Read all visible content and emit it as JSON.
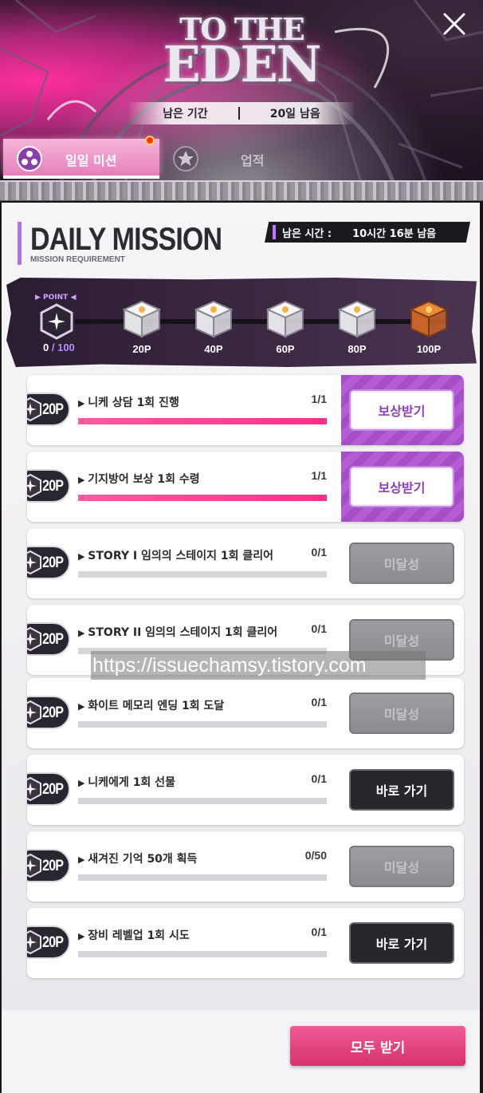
{
  "header": {
    "logo_line1": "TO THE",
    "logo_line2": "EDEN",
    "period_label": "남은 기간",
    "period_value": "20일 남음",
    "tabs": [
      {
        "label": "일일 미션",
        "active": true,
        "has_notification": true
      },
      {
        "label": "업적",
        "active": false
      }
    ]
  },
  "panel": {
    "title": "DAILY MISSION",
    "subtitle": "MISSION REQUIREMENT",
    "remaining_label": "남은 시간 :",
    "remaining_value": "10시간 16분 남음"
  },
  "points": {
    "label": "▶ POINT ◀",
    "current": "0",
    "total": "/ 100",
    "milestones": [
      {
        "label": "20P",
        "type": "silver"
      },
      {
        "label": "40P",
        "type": "silver"
      },
      {
        "label": "60P",
        "type": "silver"
      },
      {
        "label": "80P",
        "type": "silver"
      },
      {
        "label": "100P",
        "type": "gold"
      }
    ]
  },
  "missions": [
    {
      "points": "20P",
      "name": "니케 상담 1회 진행",
      "progress": "1/1",
      "fill": 1,
      "button": "보상받기",
      "state": "claim"
    },
    {
      "points": "20P",
      "name": "기지방어 보상 1회 수령",
      "progress": "1/1",
      "fill": 1,
      "button": "보상받기",
      "state": "claim"
    },
    {
      "points": "20P",
      "name": "STORY I 임의의 스테이지 1회 클리어",
      "progress": "0/1",
      "fill": 0,
      "button": "미달성",
      "state": "pending"
    },
    {
      "points": "20P",
      "name": "STORY II 임의의 스테이지 1회 클리어",
      "progress": "0/1",
      "fill": 0,
      "button": "미달성",
      "state": "pending"
    },
    {
      "points": "20P",
      "name": "화이트 메모리 엔딩 1회 도달",
      "progress": "0/1",
      "fill": 0,
      "button": "미달성",
      "state": "pending"
    },
    {
      "points": "20P",
      "name": "니케에게 1회 선물",
      "progress": "0/1",
      "fill": 0,
      "button": "바로 가기",
      "state": "go"
    },
    {
      "points": "20P",
      "name": "새겨진 기억 50개 획득",
      "progress": "0/50",
      "fill": 0,
      "button": "미달성",
      "state": "pending"
    },
    {
      "points": "20P",
      "name": "장비 레벨업 1회 시도",
      "progress": "0/1",
      "fill": 0,
      "button": "바로 가기",
      "state": "go"
    }
  ],
  "watermark_url": "https://issuechamsy.tistory.com",
  "footer": {
    "claim_all_label": "모두 받기"
  },
  "colors": {
    "accent_pink": "#e14482",
    "claim_purple": "#a44fc7",
    "progress_pink": "#ff2f86"
  }
}
